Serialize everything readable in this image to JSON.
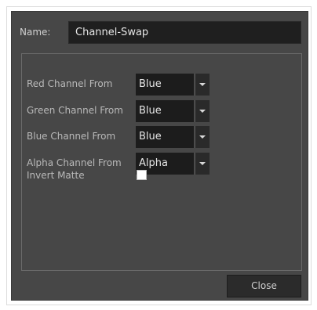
{
  "dialog": {
    "name_label": "Name:",
    "name_value": "Channel-Swap",
    "rows": [
      {
        "label": "Red Channel From",
        "value": "Blue"
      },
      {
        "label": "Green Channel From",
        "value": "Blue"
      },
      {
        "label": "Blue Channel From",
        "value": "Blue"
      },
      {
        "label": "Alpha Channel From",
        "value": "Alpha"
      }
    ],
    "invert_matte_label": "Invert Matte",
    "invert_matte_checked": false,
    "close_label": "Close"
  }
}
